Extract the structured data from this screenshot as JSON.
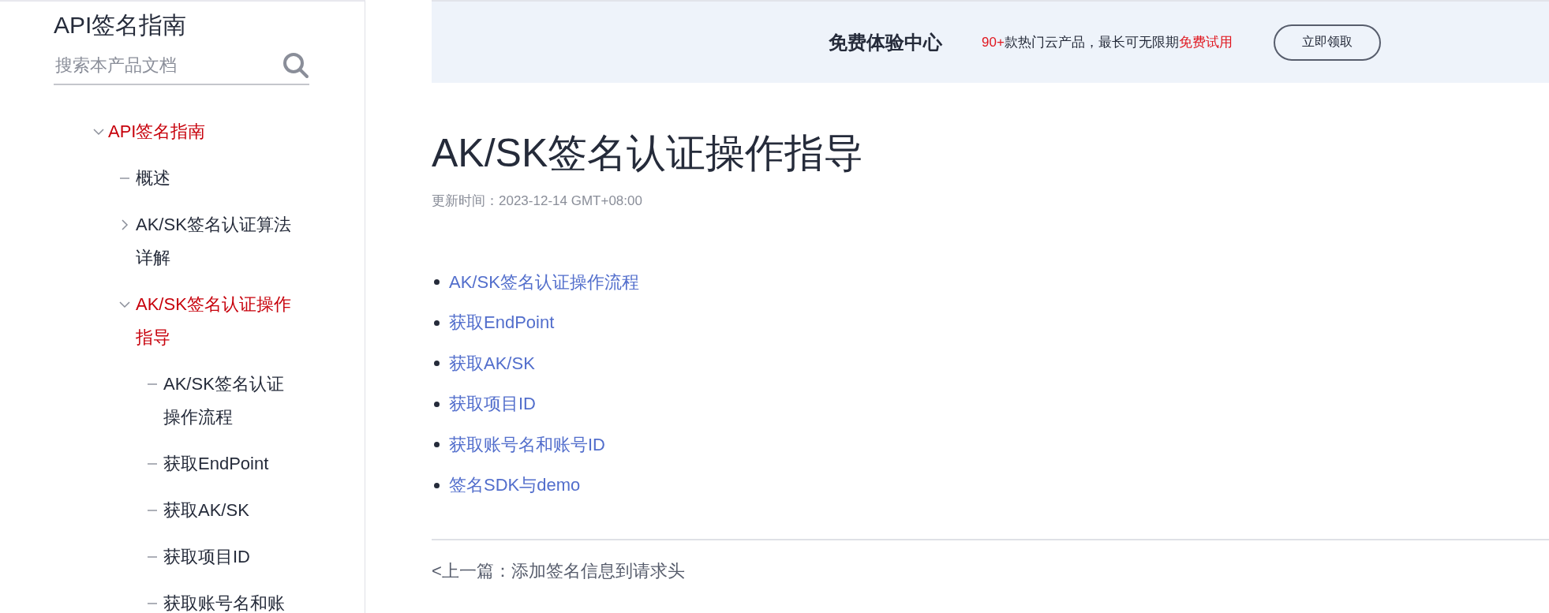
{
  "sidebar": {
    "title": "API签名指南",
    "search": {
      "placeholder": "搜索本产品文档"
    },
    "tree": [
      {
        "label": "API签名指南",
        "kind": "branch",
        "expanded": true,
        "selected": true,
        "children": [
          {
            "label": "概述",
            "kind": "leaf",
            "selected": false
          },
          {
            "label": "AK/SK签名认证算法详解",
            "kind": "branch",
            "expanded": false,
            "selected": false
          },
          {
            "label": "AK/SK签名认证操作指导",
            "kind": "branch",
            "expanded": true,
            "selected": true,
            "children": [
              {
                "label": "AK/SK签名认证操作流程",
                "kind": "leaf",
                "selected": false
              },
              {
                "label": "获取EndPoint",
                "kind": "leaf",
                "selected": false
              },
              {
                "label": "获取AK/SK",
                "kind": "leaf",
                "selected": false
              },
              {
                "label": "获取项目ID",
                "kind": "leaf",
                "selected": false
              },
              {
                "label": "获取账号名和账",
                "kind": "leaf",
                "selected": false
              }
            ]
          }
        ]
      }
    ]
  },
  "banner": {
    "title": "免费体验中心",
    "promo": [
      {
        "text": "90+",
        "highlight": true
      },
      {
        "text": "款热门云产品，最长可无限期",
        "highlight": false
      },
      {
        "text": "免费试用",
        "highlight": true
      }
    ],
    "button": "立即领取"
  },
  "article": {
    "title": "AK/SK签名认证操作指导",
    "updated": "更新时间：2023-12-14 GMT+08:00",
    "links": [
      "AK/SK签名认证操作流程",
      "获取EndPoint",
      "获取AK/SK",
      "获取项目ID",
      "获取账号名和账号ID",
      "签名SDK与demo"
    ],
    "previous": "<上一篇：添加签名信息到请求头"
  }
}
